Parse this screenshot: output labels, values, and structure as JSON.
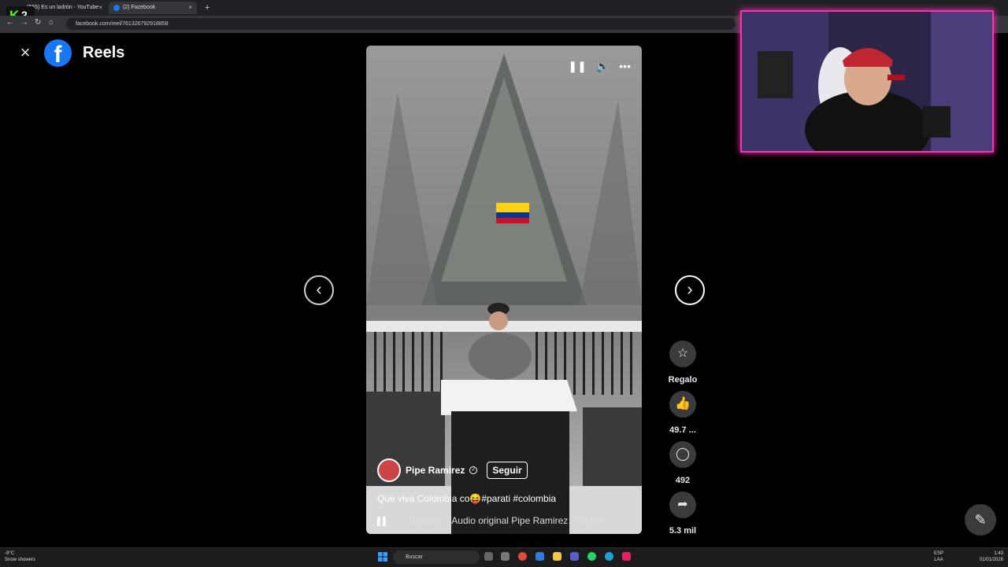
{
  "browser": {
    "tabs": [
      {
        "title": "(555) Es un ladrón - YouTube"
      },
      {
        "title": "(2) Facebook"
      }
    ],
    "new_tab": "+",
    "url": "facebook.com/reel/761326792918858"
  },
  "overlay": {
    "kick_letter": "K",
    "kick_count": "2"
  },
  "header": {
    "close_icon": "×",
    "logo_letter": "f",
    "title": "Reels"
  },
  "reel": {
    "author": "Pipe Ramirez",
    "follow_label": "Seguir",
    "caption": "Que viva Colombia co😝#parati #colombia",
    "audio_text": "Ramirez · Audio original    Pipe Ramirez · Audio o"
  },
  "actions": [
    {
      "name": "gift",
      "label": "Regalo",
      "icon": "☆"
    },
    {
      "name": "like",
      "label": "49.7 ...",
      "icon": "👍"
    },
    {
      "name": "comment",
      "label": "492",
      "icon": "◯"
    },
    {
      "name": "share",
      "label": "5.3 mil",
      "icon": "➦"
    }
  ],
  "nav": {
    "prev_icon": "‹",
    "next_icon": "›"
  },
  "taskbar": {
    "weather_temp": "-9°C",
    "weather_desc": "Snow showers",
    "search_placeholder": "Buscar",
    "lang1": "ESP",
    "lang2": "LAA",
    "time": "1:43",
    "date": "01/01/2026"
  },
  "colors": {
    "facebook_blue": "#1877f2",
    "cam_border": "#ff2fb4",
    "kick_green": "#53fc18"
  }
}
